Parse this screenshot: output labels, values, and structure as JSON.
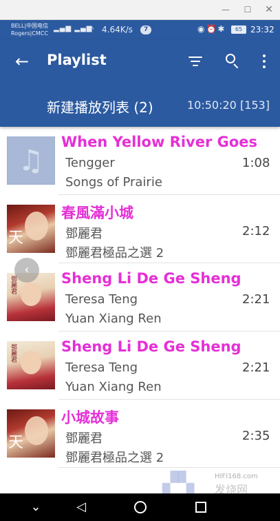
{
  "window": {
    "min_icon": "minimize-icon",
    "max_icon": "maximize-icon",
    "close_icon": "close-icon"
  },
  "status_bar": {
    "carrier_line1": "BELL|中国电信",
    "carrier_line2": "Rogers|CMCC",
    "signal": "36 36",
    "net_speed": "4.64K/s",
    "notification_count": "7",
    "battery": "65",
    "time": "23:32"
  },
  "appbar": {
    "title": "Playlist",
    "playlist_name": "新建播放列表 (2)",
    "playlist_stats": "10:50:20 [153]",
    "colors": {
      "primary": "#2c5aa0",
      "accent": "#e52fd6"
    }
  },
  "tracks": [
    {
      "title": "When Yellow River Goes",
      "artist": "Tengger",
      "album": "Songs of Prairie",
      "duration": "1:08",
      "cover": "default-music-note"
    },
    {
      "title": "春風滿小城",
      "artist": "鄧麗君",
      "album": "鄧麗君極品之選 2",
      "duration": "2:12",
      "cover": "teresa-teng-portrait",
      "cover_text": "天"
    },
    {
      "title": "Sheng Li De Ge Sheng",
      "artist": "Teresa Teng",
      "album": "Yuan Xiang Ren",
      "duration": "2:21",
      "cover": "yuan-xiang-ren-cover",
      "cover_text": "鄧麗君"
    },
    {
      "title": "Sheng Li De Ge Sheng",
      "artist": "Teresa Teng",
      "album": "Yuan Xiang Ren",
      "duration": "2:21",
      "cover": "yuan-xiang-ren-cover",
      "cover_text": "鄧麗君"
    },
    {
      "title": "小城故事",
      "artist": "鄧麗君",
      "album": "鄧麗君極品之選 2",
      "duration": "2:35",
      "cover": "teresa-teng-portrait",
      "cover_text": "天"
    }
  ],
  "watermark": {
    "site": "HIFI168.com",
    "name": "发烧网"
  }
}
